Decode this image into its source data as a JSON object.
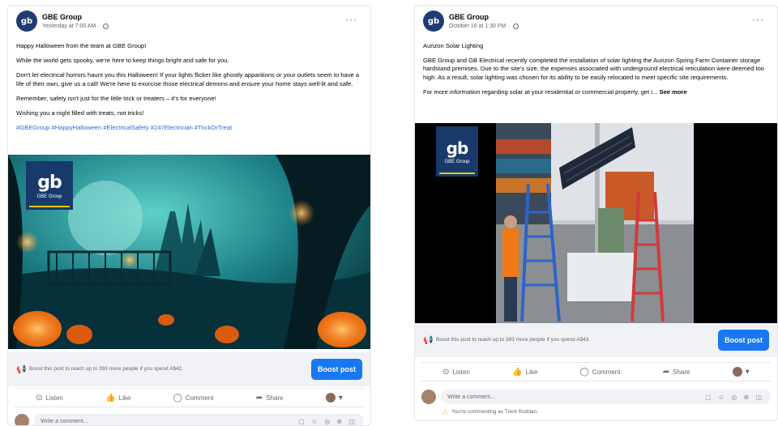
{
  "left_post": {
    "page_name": "GBE Group",
    "timestamp": "Yesterday at 7:00 AM",
    "more": "···",
    "paragraphs": [
      "Happy Halloween from the team at GBE Group!",
      "While the world gets spooky, we're here to keep things bright and safe for you.",
      "Don't let electrical horrors haunt you this Halloween! If your lights flicker like ghostly apparitions or your outlets seem to have a life of their own, give us a call! We're here to exorcise those electrical demons and ensure your home stays well-lit and safe.",
      "Remember, safety isn't just for the little trick or treaters – it's for everyone!",
      "Wishing you a night filled with treats, not tricks!"
    ],
    "hashtags": "#GBEGroup #HappyHalloween #ElectricalSafety #247Electrician #TrickOrTreat",
    "brand_logo": "gb",
    "brand_name": "GBE Group",
    "boost_text": "Boost this post to reach up to 393 more people if you spend A$42.",
    "boost_button": "Boost post",
    "actions": {
      "listen": "Listen",
      "like": "Like",
      "comment": "Comment",
      "share": "Share"
    },
    "comment_placeholder": "Write a comment...",
    "comment_tools": "▢ ☺ ◎ ⊕ ◫"
  },
  "right_post": {
    "page_name": "GBE Group",
    "timestamp": "October 16 at 1:30 PM",
    "more": "···",
    "title": "Aurizon Solar Lighting",
    "body": "GBE Group and GB Electrical recently completed the installation of solar lighting the Aurizon Spring Farm Container storage hardstand premises. Due to the site's size, the expenses associated with underground electrical reticulation were deemed too high. As a result, solar lighting was chosen for its ability to be easily relocated to meet specific site requirements.",
    "more_info": "For more information regarding solar at your residential or commercial property, get i...",
    "see_more": "See more",
    "brand_logo": "gb",
    "brand_name": "GBE Group",
    "boost_text": "Boost this post to reach up to 393 more people if you spend A$43.",
    "boost_button": "Boost post",
    "actions": {
      "listen": "Listen",
      "like": "Like",
      "comment": "Comment",
      "share": "Share"
    },
    "comment_placeholder": "Write a comment...",
    "comment_tools": "▢ ☺ ◎ ⊕ ◫",
    "commenting_as": "You're commenting as Trent Roddan."
  },
  "colors": {
    "accent": "#1877f2",
    "brand": "#173a6b",
    "brand_yellow": "#f2c200",
    "hashtag": "#216fdb"
  }
}
